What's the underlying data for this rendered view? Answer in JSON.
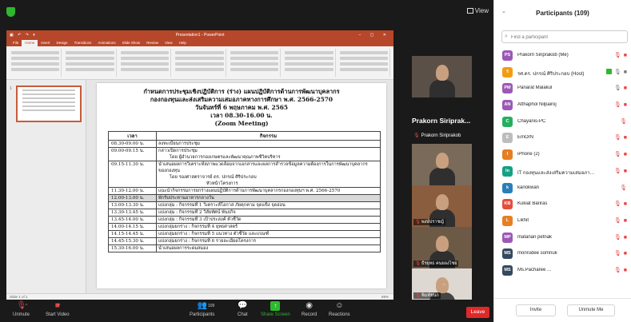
{
  "topbar": {
    "view_label": "View"
  },
  "ppt": {
    "window_title": "Presentation1 - PowerPoint",
    "tabs": [
      "File",
      "Home",
      "Insert",
      "Design",
      "Transitions",
      "Animations",
      "Slide Show",
      "Review",
      "View",
      "Help"
    ],
    "active_tab": "Home",
    "thumb_number": "1",
    "status_left": "Slide 1 of 1",
    "status_zoom": "69%"
  },
  "slide": {
    "title_lines": [
      "กำหนดการประชุมเชิงปฏิบัติการ (ร่าง) แผนปฏิบัติการด้านการพัฒนาบุคลากร",
      "กองกองทุนและส่งเสริมความเสมอภาคทางการศึกษา พ.ศ. 2566-2570",
      "วันจันทร์ที่ 6 พฤษภาคม พ.ศ. 2565",
      "เวลา 08.30-16.00 น.",
      "(Zoom Meeting)"
    ],
    "table_headers": [
      "เวลา",
      "กิจกรรม"
    ],
    "rows": [
      {
        "time": "08.30-09.00 น.",
        "lines": [
          "ลงทะเบียนการประชุม"
        ],
        "hl": false
      },
      {
        "time": "09.00-09.15 น.",
        "lines": [
          "กล่าวเปิดการประชุม",
          "โดย ผู้อำนวยการกองเกษตรและพัฒนาคุณภาพชีวิตบริหาร"
        ],
        "hl": false
      },
      {
        "time": "09.15-11.30 น.",
        "lines": [
          "นำเสนอผลการวิเคราะห์สภาพแวดล้อมจากเอกสารและผลการสำรวจข้อมูลความต้องการในการพัฒนาบุคลากรของกองทุน",
          "โดย รองศาสตราจารย์ ดร. ปกรณ์ ศิริประกอบ",
          "หัวหน้าโครงการ"
        ],
        "hl": false
      },
      {
        "time": "11.30-12.00 น.",
        "lines": [
          "แนะนำกิจกรรมการยกร่างแผนปฏิบัติการด้านการพัฒนาบุคลากรกองกองทุนฯ พ.ศ. 2566-2570"
        ],
        "hl": false
      },
      {
        "time": "12.00-13.00 น.",
        "lines": [
          "พักรับประทานอาหารกลางวัน"
        ],
        "hl": true
      },
      {
        "time": "13.00-13.30 น.",
        "lines": [
          "แบ่งกลุ่ม : กิจกรรมที่ 1 วิเคราะห์โอกาส ภัยคุกคาม จุดแข็ง จุดอ่อน"
        ],
        "hl": false
      },
      {
        "time": "13.30-13.45 น.",
        "lines": [
          "แบ่งกลุ่ม : กิจกรรมที่ 2 วิสัยทัศน์ พันธกิจ"
        ],
        "hl": false
      },
      {
        "time": "13.45-14.00 น.",
        "lines": [
          "แบ่งกลุ่ม : กิจกรรมที่ 3 เป้าประสงค์ ตัวชี้วัด"
        ],
        "hl": false
      },
      {
        "time": "14.00-14.15 น.",
        "lines": [
          "แบ่งกลุ่มยกร่าง : กิจกรรมที่ 4 ยุทธศาสตร์"
        ],
        "hl": false
      },
      {
        "time": "14.15-14.45 น.",
        "lines": [
          "แบ่งกลุ่มยกร่าง : กิจกรรมที่ 5 แนวทาง ตัวชี้วัด และเกณฑ์"
        ],
        "hl": false
      },
      {
        "time": "14.45-15.30 น.",
        "lines": [
          "แบ่งกลุ่มยกร่าง : กิจกรรมที่ 6 รายละเอียดโครงการ"
        ],
        "hl": false
      },
      {
        "time": "15.30-16.00 น.",
        "lines": [
          "นำเสนอผลการระดมสมอง"
        ],
        "hl": false
      }
    ]
  },
  "videos": {
    "speaker_name": "Prakorn Siriprak...",
    "speaker_sub": "Prakorn Siriprakob",
    "tiles": [
      {
        "name": "",
        "bg": "#5a5048"
      },
      {
        "name": "",
        "bg": "#7a6a5a"
      },
      {
        "name": "พงษ์ปราชญ์",
        "bg": "#8a5d3e"
      },
      {
        "name": "ธีรยุทธ คนยองไชย",
        "bg": "#6d5a46"
      },
      {
        "name": "พิมพ์ชนก",
        "bg": "#ddd8d2"
      }
    ]
  },
  "toolbar": {
    "unmute": "Unmute",
    "start_video": "Start Video",
    "participants": "Participants",
    "participant_count": "109",
    "chat": "Chat",
    "share_screen": "Share Screen",
    "record": "Record",
    "reactions": "Reactions",
    "leave": "Leave"
  },
  "panel": {
    "title": "Participants (109)",
    "search_placeholder": "Find a participant",
    "participants": [
      {
        "initials": "PS",
        "name": "Prakorn Siriprakob (Me)",
        "color": "#9b59b6",
        "mic": "off",
        "cam": "off"
      },
      {
        "initials": "ร",
        "name": "รศ.ดร. ปกรณ์ ศิริประกอบ (Host)",
        "color": "#f39c12",
        "mic": "share",
        "cam": "on"
      },
      {
        "initials": "PM",
        "name": "Panarat Malakul",
        "color": "#9b59b6",
        "mic": "on",
        "cam": "off"
      },
      {
        "initials": "AN",
        "name": "Atthaphol Nilpairoj",
        "color": "#9b59b6",
        "mic": "off",
        "cam": "off"
      },
      {
        "initials": "C",
        "name": "Chayanis-PC",
        "color": "#27ae60",
        "mic": "off",
        "cam": ""
      },
      {
        "initials": "E",
        "name": "EmOrN",
        "color": "#bdbdbd",
        "mic": "off",
        "cam": "off"
      },
      {
        "initials": "I",
        "name": "iPhone (2)",
        "color": "#e67e22",
        "mic": "off",
        "cam": "off"
      },
      {
        "initials": "In",
        "name": "IT กองทุนและส่งเสริมความเสมอภาคทางการศึกษา",
        "color": "#16a085",
        "mic": "off",
        "cam": "off"
      },
      {
        "initials": "k",
        "name": "kanokwan",
        "color": "#2980b9",
        "mic": "off",
        "cam": ""
      },
      {
        "initials": "KB",
        "name": "Kukiat Bariras",
        "color": "#e74c3c",
        "mic": "off",
        "cam": "off"
      },
      {
        "initials": "L",
        "name": "Likhit",
        "color": "#e67e22",
        "mic": "off",
        "cam": "off"
      },
      {
        "initials": "MP",
        "name": "matanan petnak",
        "color": "#9b59b6",
        "mic": "off",
        "cam": "off"
      },
      {
        "initials": "MS",
        "name": "monrudee somnuk",
        "color": "#34495e",
        "mic": "off",
        "cam": "off"
      },
      {
        "initials": "MS",
        "name": "Ms.Pacharee ...",
        "color": "#34495e",
        "mic": "off",
        "cam": "off"
      }
    ],
    "invite": "Invite",
    "unmute_me": "Unmute Me"
  }
}
